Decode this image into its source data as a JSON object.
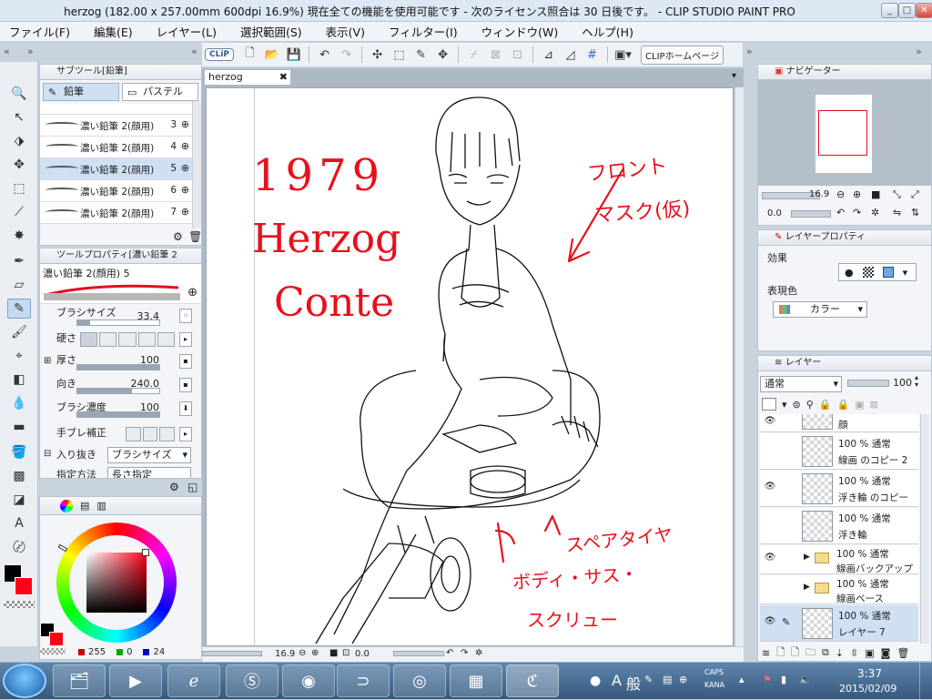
{
  "window": {
    "title": "herzog (182.00 x 257.00mm 600dpi 16.9%)  現在全ての機能を使用可能です - 次のライセンス照合は 30 日後です。 - CLIP STUDIO PAINT PRO",
    "min": "_",
    "max": "□",
    "close": "✕"
  },
  "menu": [
    "ファイル(F)",
    "編集(E)",
    "レイヤー(L)",
    "選択範囲(S)",
    "表示(V)",
    "フィルター(I)",
    "ウィンドウ(W)",
    "ヘルプ(H)"
  ],
  "toolbar": {
    "logo": "CLiP",
    "home_button": "CLIPホームページ"
  },
  "subtool": {
    "title": "サブツール[鉛筆]",
    "tab_pencil": "鉛筆",
    "tab_pastel": "パステル",
    "brushes": [
      {
        "name": "濃い鉛筆 2(顔用)",
        "num": "3"
      },
      {
        "name": "濃い鉛筆 2(顔用)",
        "num": "4"
      },
      {
        "name": "濃い鉛筆 2(顔用)",
        "num": "5"
      },
      {
        "name": "濃い鉛筆 2(顔用)",
        "num": "6"
      },
      {
        "name": "濃い鉛筆 2(顔用)",
        "num": "7"
      }
    ]
  },
  "toolprop": {
    "title": "ツールプロパティ[濃い鉛筆 2",
    "brush_name": "濃い鉛筆 2(顔用) 5",
    "brush_size_label": "ブラシサイズ",
    "brush_size_value": "33.4",
    "hardness_label": "硬さ",
    "thickness_label": "厚さ",
    "thickness_value": "100",
    "direction_label": "向き",
    "direction_value": "240.0",
    "density_label": "ブラシ濃度",
    "density_value": "100",
    "stabilization_label": "手ブレ補正",
    "taper_label": "入り抜き",
    "taper_value": "ブラシサイズ",
    "method_label": "指定方法",
    "method_value": "長さ指定"
  },
  "color": {
    "r": "255",
    "g": "0",
    "b": "24",
    "main_color": "#ff0018"
  },
  "document": {
    "tab": "herzog",
    "close": "✖"
  },
  "canvas_text": {
    "year": "1979",
    "name1": "Herzog",
    "name2": "Conte",
    "note1a": "フロント",
    "note1b": "マスク(仮)",
    "note2": "スペアタイヤ",
    "note3a": "ボディ・サス・",
    "note3b": "スクリュー"
  },
  "canvas_status": {
    "zoom": "16.9",
    "rotate": "0.0"
  },
  "navigator": {
    "title": "ナビゲーター",
    "zoom": "16.9",
    "rotate": "0.0"
  },
  "layerprop": {
    "title": "レイヤープロパティ",
    "effect_label": "効果",
    "expression_label": "表現色",
    "expression_value": "カラー"
  },
  "layers": {
    "title": "レイヤー",
    "blend_mode": "通常",
    "opacity": "100",
    "rows": [
      {
        "l1": "顔",
        "l2": ""
      },
      {
        "l1": "100 % 通常",
        "l2": "線画 のコピー 2"
      },
      {
        "l1": "100 % 通常",
        "l2": "浮き輪 のコピー"
      },
      {
        "l1": "100 % 通常",
        "l2": "浮き輪"
      },
      {
        "l1": "100 % 通常",
        "l2": "線画バックアップ"
      },
      {
        "l1": "100 % 通常",
        "l2": "線画ベース"
      },
      {
        "l1": "100 % 通常",
        "l2": "レイヤー 7"
      }
    ]
  },
  "taskbar": {
    "ime_a": "A",
    "ime_mode": "般",
    "caps": "CAPS",
    "kana": "KANA",
    "time": "3:37",
    "date": "2015/02/09"
  }
}
